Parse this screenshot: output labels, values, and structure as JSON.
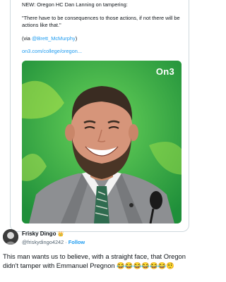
{
  "quoted_tweet": {
    "headline": "NEW: Oregon HC Dan Lanning on tampering:",
    "quote": "\"There have to be consequences to those actions, if not there will be actions like that.\"",
    "via_prefix": "(via ",
    "via_handle": "@Brett_McMurphy",
    "via_suffix": ")",
    "link": "on3.com/college/oregon...",
    "image_logo": "On3"
  },
  "tweet": {
    "author_name": "Frisky Dingo",
    "author_badge": "👑",
    "author_handle": "@friskydingo4242",
    "separator": "·",
    "follow_label": "Follow",
    "text": "This man wants us to believe, with a straight face, that Oregon didn't tamper with Emmanuel Pregnon 😂😂😂😂😂😂🤨"
  },
  "colors": {
    "accent": "#1d9bf0",
    "photo_background": "#39b94a"
  }
}
